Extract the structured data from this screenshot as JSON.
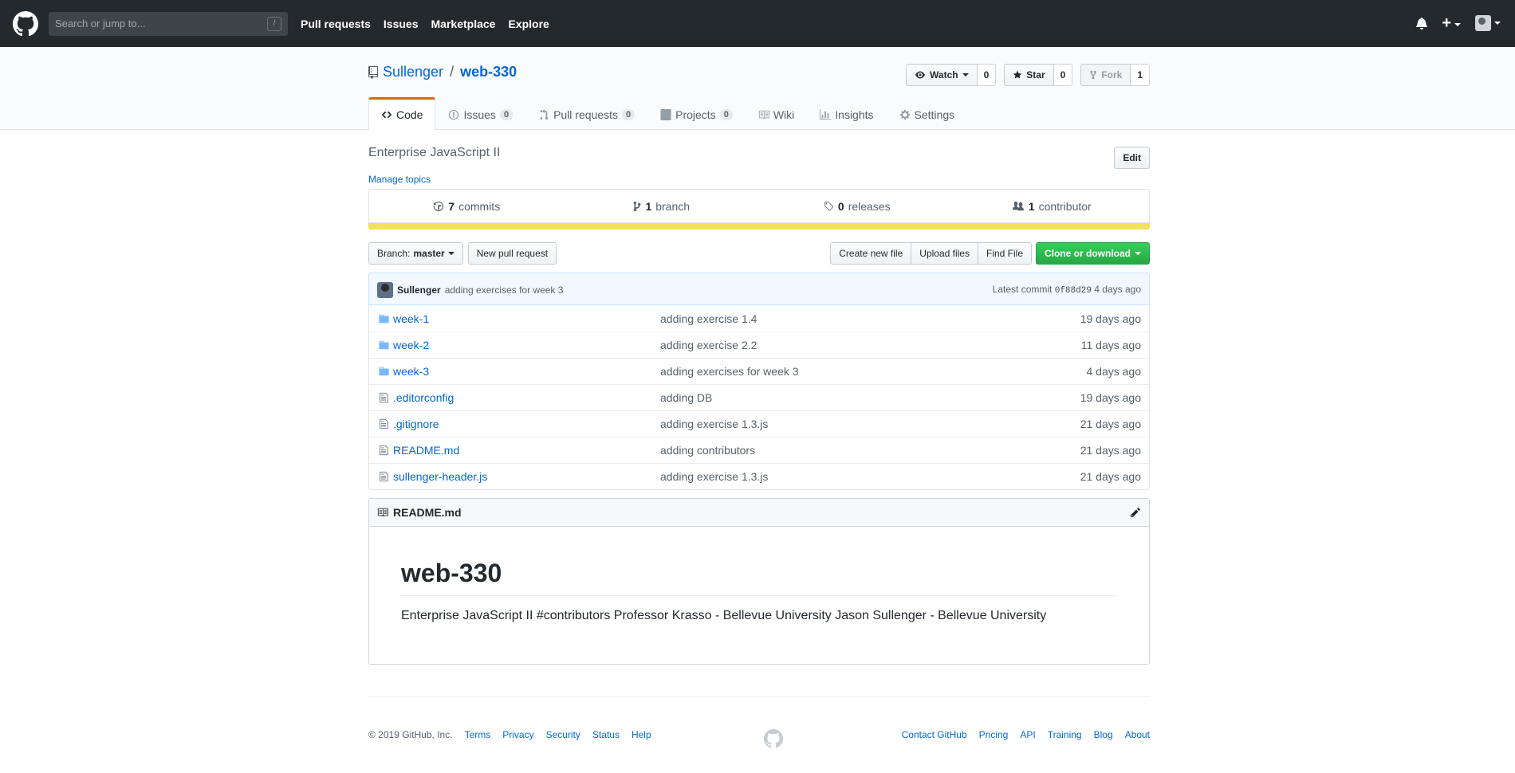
{
  "header": {
    "search_placeholder": "Search or jump to...",
    "slash_key": "/",
    "nav": [
      "Pull requests",
      "Issues",
      "Marketplace",
      "Explore"
    ]
  },
  "repo": {
    "owner": "Sullenger",
    "separator": "/",
    "name": "web-330",
    "watch_label": "Watch",
    "watch_count": "0",
    "star_label": "Star",
    "star_count": "0",
    "fork_label": "Fork",
    "fork_count": "1"
  },
  "tabs": [
    {
      "label": "Code",
      "count": ""
    },
    {
      "label": "Issues",
      "count": "0"
    },
    {
      "label": "Pull requests",
      "count": "0"
    },
    {
      "label": "Projects",
      "count": "0"
    },
    {
      "label": "Wiki",
      "count": ""
    },
    {
      "label": "Insights",
      "count": ""
    },
    {
      "label": "Settings",
      "count": ""
    }
  ],
  "description": "Enterprise JavaScript II",
  "manage_topics": "Manage topics",
  "edit_label": "Edit",
  "numbers": {
    "commits_num": "7",
    "commits_label": "commits",
    "branch_num": "1",
    "branch_label": "branch",
    "releases_num": "0",
    "releases_label": "releases",
    "contributor_num": "1",
    "contributor_label": "contributor"
  },
  "language_color": "#f1e05a",
  "file_nav": {
    "branch_prefix": "Branch:",
    "branch_name": "master",
    "new_pr": "New pull request",
    "create_file": "Create new file",
    "upload": "Upload files",
    "find": "Find File",
    "clone": "Clone or download"
  },
  "commit": {
    "author": "Sullenger",
    "message": "adding exercises for week 3",
    "latest_label": "Latest commit",
    "sha": "0f88d29",
    "age": "4 days ago"
  },
  "files": [
    {
      "type": "dir",
      "name": "week-1",
      "message": "adding exercise 1.4",
      "age": "19 days ago"
    },
    {
      "type": "dir",
      "name": "week-2",
      "message": "adding exercise 2.2",
      "age": "11 days ago"
    },
    {
      "type": "dir",
      "name": "week-3",
      "message": "adding exercises for week 3",
      "age": "4 days ago"
    },
    {
      "type": "file",
      "name": ".editorconfig",
      "message": "adding DB",
      "age": "19 days ago"
    },
    {
      "type": "file",
      "name": ".gitignore",
      "message": "adding exercise 1.3.js",
      "age": "21 days ago"
    },
    {
      "type": "file",
      "name": "README.md",
      "message": "adding contributors",
      "age": "21 days ago"
    },
    {
      "type": "file",
      "name": "sullenger-header.js",
      "message": "adding exercise 1.3.js",
      "age": "21 days ago"
    }
  ],
  "readme": {
    "file_label": "README.md",
    "heading": "web-330",
    "body": "Enterprise JavaScript II #contributors Professor Krasso - Bellevue University Jason Sullenger - Bellevue University"
  },
  "footer": {
    "copyright": "© 2019 GitHub, Inc.",
    "left_links": [
      "Terms",
      "Privacy",
      "Security",
      "Status",
      "Help"
    ],
    "right_links": [
      "Contact GitHub",
      "Pricing",
      "API",
      "Training",
      "Blog",
      "About"
    ]
  }
}
